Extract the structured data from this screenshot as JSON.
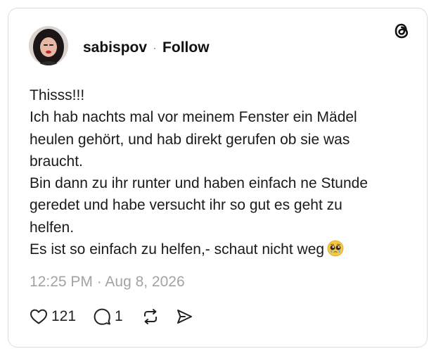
{
  "post": {
    "username": "sabispov",
    "separator": "·",
    "follow_label": "Follow",
    "text_lines": [
      "Thisss!!!",
      "Ich hab nachts mal vor meinem Fenster ein Mädel",
      "heulen gehört, und hab direkt gerufen ob sie was",
      "braucht.",
      "Bin dann zu ihr runter und haben einfach ne Stunde",
      "geredet und habe versucht ihr so gut es geht zu",
      "helfen.",
      "Es ist so einfach zu helfen,- schaut nicht weg"
    ],
    "timestamp": "12:25 PM · Aug 8, 2026",
    "likes": "121",
    "replies": "1"
  },
  "icons": {
    "brand": "threads-logo-icon",
    "like": "heart-icon",
    "reply": "comment-icon",
    "repost": "repost-icon",
    "share": "send-icon",
    "emoji": "pleading-face-emoji"
  }
}
